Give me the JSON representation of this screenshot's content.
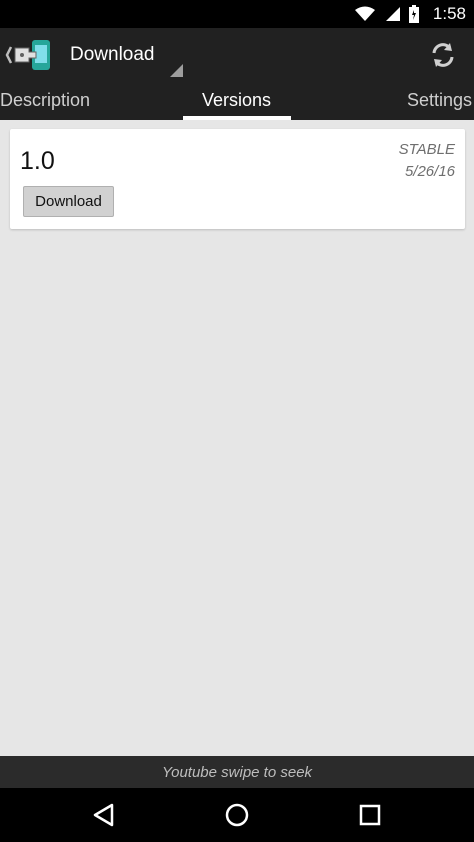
{
  "status_bar": {
    "time": "1:58",
    "icons": [
      "wifi-icon",
      "signal-icon",
      "battery-icon"
    ]
  },
  "app_bar": {
    "title": "Download",
    "back_icon": "app-logo-back-icon",
    "refresh_icon": "refresh-icon"
  },
  "tabs": [
    {
      "label": "Description",
      "selected": false
    },
    {
      "label": "Versions",
      "selected": true
    },
    {
      "label": "Settings",
      "selected": false
    }
  ],
  "versions": [
    {
      "version": "1.0",
      "stability": "STABLE",
      "date": "5/26/16",
      "button_label": "Download"
    }
  ],
  "toast": {
    "text": "Youtube swipe to seek"
  },
  "nav_bar": {
    "icons": [
      "back-nav-icon",
      "home-nav-icon",
      "recents-nav-icon"
    ]
  },
  "colors": {
    "app_bar": "#212121",
    "background": "#e6e6e6",
    "card": "#ffffff",
    "accent_indicator": "#ffffff"
  }
}
